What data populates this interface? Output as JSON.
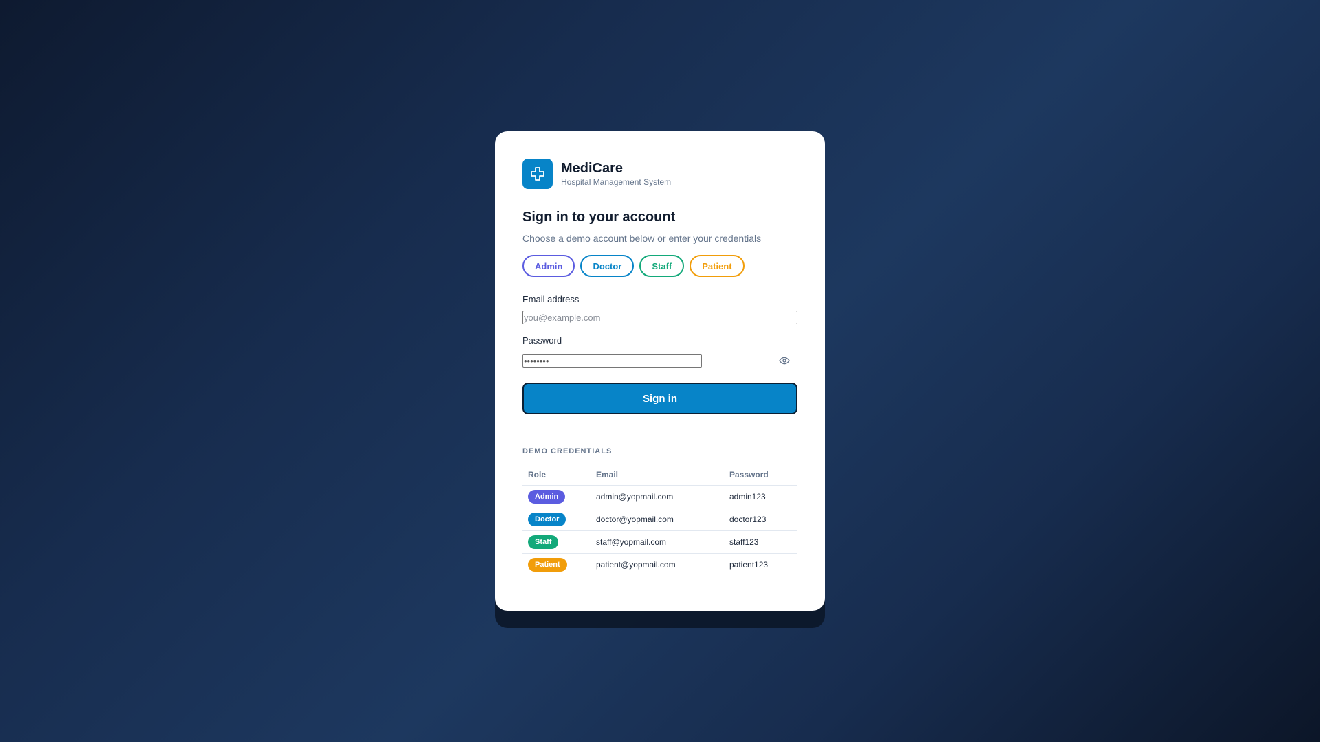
{
  "brand": {
    "name": "MediCare",
    "subtitle": "Hospital Management System",
    "logo_icon": "medical-cross-icon",
    "logo_color": "#0784c8"
  },
  "form": {
    "heading": "Sign in to your account",
    "subheading": "Choose a demo account below or enter your credentials",
    "role_pills": [
      {
        "label": "Admin",
        "color": "#5b5ce0"
      },
      {
        "label": "Doctor",
        "color": "#0784c8"
      },
      {
        "label": "Staff",
        "color": "#13a97a"
      },
      {
        "label": "Patient",
        "color": "#f19d0a"
      }
    ],
    "email_label": "Email address",
    "email_placeholder": "you@example.com",
    "email_value": "",
    "password_label": "Password",
    "password_value": "••••••••",
    "password_toggle_icon": "eye-icon",
    "submit_label": "Sign in",
    "submit_color": "#0784c8"
  },
  "demo": {
    "title": "DEMO CREDENTIALS",
    "columns": [
      "Role",
      "Email",
      "Password"
    ],
    "rows": [
      {
        "role": "Admin",
        "email": "admin@yopmail.com",
        "password": "admin123",
        "color": "#5b5ce0"
      },
      {
        "role": "Doctor",
        "email": "doctor@yopmail.com",
        "password": "doctor123",
        "color": "#0784c8"
      },
      {
        "role": "Staff",
        "email": "staff@yopmail.com",
        "password": "staff123",
        "color": "#13a97a"
      },
      {
        "role": "Patient",
        "email": "patient@yopmail.com",
        "password": "patient123",
        "color": "#f19d0a"
      }
    ]
  }
}
